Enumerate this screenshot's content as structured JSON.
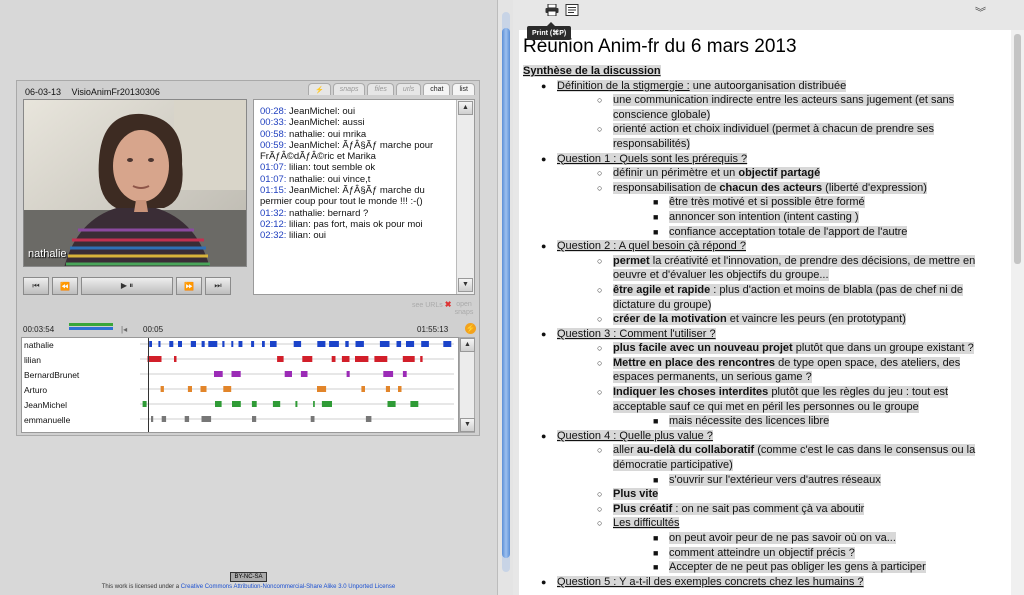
{
  "player": {
    "date": "06-03-13",
    "room": "VisioAnimFr20130306",
    "tabs": [
      "⚡",
      "snaps",
      "files",
      "urls",
      "chat",
      "list"
    ],
    "active_tab": "chat",
    "video_name": "nathalie",
    "controls": [
      "⏮",
      "⏪",
      "▶ ⏸",
      "⏩",
      "⏭"
    ],
    "chat": [
      {
        "t": "00:28:",
        "m": " JeanMichel: oui"
      },
      {
        "t": "00:33:",
        "m": " JeanMichel: aussi"
      },
      {
        "t": "00:58:",
        "m": " nathalie: oui mrika"
      },
      {
        "t": "00:59:",
        "m": " JeanMichel: ÃƒÂ§Ãƒ marche pour FrÃƒÂ©dÃƒÂ©ric et Marika"
      },
      {
        "t": "01:07:",
        "m": " lilian: tout semble ok"
      },
      {
        "t": "01:07:",
        "m": " nathalie: oui vince,t"
      },
      {
        "t": "01:15:",
        "m": " JeanMichel: ÃƒÂ§Ãƒ marche du permier coup pour tout le monde !!! :-()"
      },
      {
        "t": "01:32:",
        "m": " nathalie: bernard ?"
      },
      {
        "t": "02:12:",
        "m": " lilian: pas fort, mais ok pour moi"
      },
      {
        "t": "02:32:",
        "m": " lilian: oui"
      }
    ],
    "see_urls": "see URLs",
    "open_snaps": "open snaps",
    "time_elapsed": "00:03:54",
    "time_start": "00:05",
    "time_end": "01:55:13",
    "participants": [
      "nathalie",
      "lilian",
      "BernardBrunet",
      "Arturo",
      "JeanMichel",
      "emmanuelle"
    ],
    "participant_colors": [
      "#1b43c9",
      "#d21f2a",
      "#9b2bb6",
      "#e2852a",
      "#2f9b36",
      "#777777"
    ]
  },
  "license": {
    "badge": "BY-NC-SA",
    "prefix": "This work is licensed under a ",
    "link": "Creative Commons Attribution-Noncommercial-Share Alike 3.0 Unported License"
  },
  "doc_toolbar": {
    "tooltip": "Print (⌘P)",
    "print_icon": "printer-icon",
    "notes_icon": "notes-icon",
    "collapse": "»"
  },
  "doc": {
    "title": "Réunion Anim-fr du 6 mars 2013",
    "synthese": "Synthèse de la discussion",
    "s1": "Définition de la stigmergie :",
    "s1_rest": " une autoorganisation distribuée",
    "s1_a": "une communication indirecte entre les acteurs sans jugement (et sans conscience globale)",
    "s1_b": "orienté action et choix individuel (permet à chacun de prendre ses responsabilités)",
    "s2": "Question 1 : Quels sont les prérequis ?",
    "s2_a1": "définir un périmètre et un ",
    "s2_a2": "objectif partagé",
    "s2_b1": "responsabilisation de ",
    "s2_b2": "chacun des acteurs",
    "s2_b3": " (liberté d'expression)",
    "s2_b_i": "être très motivé et si possible être formé",
    "s2_b_ii": "annoncer son intention (intent casting )",
    "s2_b_iii": "confiance acceptation totale de l'apport de l'autre",
    "s3": "Question 2 : A quel besoin çà répond ?",
    "s3_a1": "permet",
    "s3_a2": " la créativité et l'innovation, de prendre des décisions, de mettre en oeuvre et d'évaluer les objectifs du groupe...",
    "s3_b1": "être agile et rapide",
    "s3_b2": " : plus d'action et moins de blabla (pas de chef ni de dictature du groupe)",
    "s3_c1": "créer de la motivation",
    "s3_c2": " et vaincre les peurs (en prototypant)",
    "s4": "Question 3 : Comment l'utiliser ?",
    "s4_a1": "plus facile avec un nouveau projet",
    "s4_a2": " plutôt que dans un groupe existant ?",
    "s4_b1": "Mettre en place des rencontres",
    "s4_b2": " de type open space, des ateliers, des espaces permanents, un serious game ?",
    "s4_c1": "Indiquer les choses interdites",
    "s4_c2": " plutôt que les règles du jeu : tout est acceptable sauf ce qui met en péril les personnes ou le groupe",
    "s4_c_i": "mais nécessite des licences libre",
    "s5": "Question 4 : Quelle plus value ?",
    "s5_a1": "aller ",
    "s5_a2": "au-delà du collaboratif",
    "s5_a3": " (comme c'est le cas dans le consensus ou la démocratie participative)",
    "s5_a_i": "s'ouvrir sur l'extérieur vers d'autres réseaux",
    "s5_b": "Plus vite",
    "s5_c1": "Plus créatif",
    "s5_c2": " : on ne sait pas comment çà va aboutir",
    "s5_d": "Les difficultés",
    "s5_d_i": "on peut avoir peur de ne pas savoir où on va...",
    "s5_d_ii": "comment atteindre un objectif précis ?",
    "s5_d_iii": "Accepter de ne peut pas obliger les gens à participer",
    "s6": "Question 5 : Y a-t-il des exemples concrets chez les humains ?"
  }
}
